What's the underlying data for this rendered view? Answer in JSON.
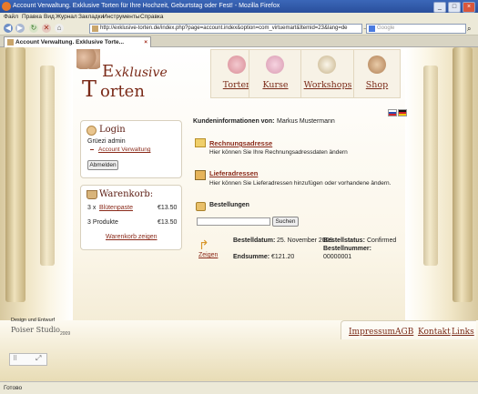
{
  "window": {
    "title": "Account Verwaltung. Exklusive Torten für Ihre Hochzeit, Geburtstag oder Fest! - Mozilla Firefox",
    "min": "_",
    "max": "□",
    "close": "×"
  },
  "menu": [
    "Файл",
    "Правка",
    "Вид",
    "Журнал",
    "Закладки",
    "Инструменты",
    "Справка"
  ],
  "nav": {
    "url": "http://exklusive-torten.de/index.php?page=account.index&option=com_virtuemart&Itemid=23&lang=de",
    "search_placeholder": "Google",
    "go": "→"
  },
  "tab": {
    "label": "Account Verwaltung. Exklusive Torte...",
    "close": "×"
  },
  "logo": {
    "initial1": "E",
    "rest1": "xklusive",
    "initial2": "T",
    "rest2": "orten"
  },
  "topnav": [
    "Torten",
    "Kurse",
    "Workshops",
    "Shop"
  ],
  "login": {
    "title": "Login",
    "greeting": "Grüezi admin",
    "account_link": "Account Verwaltung",
    "logout": "Abmelden"
  },
  "cart": {
    "title": "Warenkorb:",
    "line1_qty": "3 x",
    "line1_item": "Blütenpaste",
    "line1_price": "€13.50",
    "line2_label": "3 Produkte",
    "line2_price": "€13.50",
    "show_link": "Warenkorb zeigen"
  },
  "main": {
    "info_label": "Kundeninformationen von:",
    "customer": "Markus Mustermann",
    "billing_title": "Rechnungsadresse",
    "billing_desc": "Hier können Sie Ihre Rechnungsadressdaten ändern",
    "shipping_title": "Lieferadressen",
    "shipping_desc": "Hier können Sie Lieferadressen hinzufügen oder vorhandene ändern.",
    "orders_title": "Bestellungen",
    "search_button": "Suchen",
    "show_label": "Zeigen",
    "order_date_label": "Bestelldatum:",
    "order_date": "25. November 2009",
    "order_status_label": "Bestellstatus:",
    "order_status": "Confirmed",
    "order_total_label": "Endsumme:",
    "order_total": "€121.20",
    "order_number_label": "Bestellnummer:",
    "order_number": "00000001"
  },
  "footer": {
    "design_line": "Design und Entwurf",
    "studio": "Poiser Studio",
    "year": "2009",
    "links": [
      "Impressum",
      "AGB",
      "Kontakt",
      "Links"
    ]
  },
  "status": {
    "text": "Готово"
  },
  "colors": {
    "accent": "#7a2a18",
    "link": "#8a2a1a",
    "titlebar": "#2a4f9c"
  }
}
